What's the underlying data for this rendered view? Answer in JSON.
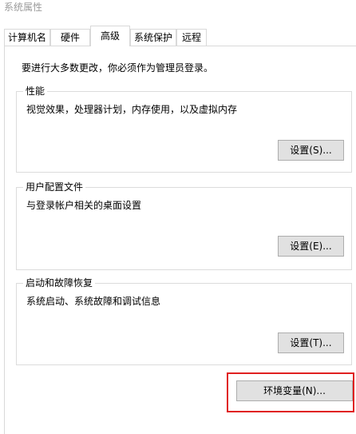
{
  "window": {
    "title": "系统属性"
  },
  "tabs": [
    {
      "label": "计算机名",
      "active": false
    },
    {
      "label": "硬件",
      "active": false
    },
    {
      "label": "高级",
      "active": true
    },
    {
      "label": "系统保护",
      "active": false
    },
    {
      "label": "远程",
      "active": false
    }
  ],
  "admin_note": "要进行大多数更改，你必须作为管理员登录。",
  "performance": {
    "legend": "性能",
    "description": "视觉效果，处理器计划，内存使用，以及虚拟内存",
    "button": "设置(S)..."
  },
  "user_profiles": {
    "legend": "用户配置文件",
    "description": "与登录帐户相关的桌面设置",
    "button": "设置(E)..."
  },
  "startup_recovery": {
    "legend": "启动和故障恢复",
    "description": "系统启动、系统故障和调试信息",
    "button": "设置(T)..."
  },
  "environment_button": "环境变量(N)...",
  "colors": {
    "highlight": "#e02020",
    "button_bg": "#e1e1e1",
    "border": "#d9d9d9"
  }
}
